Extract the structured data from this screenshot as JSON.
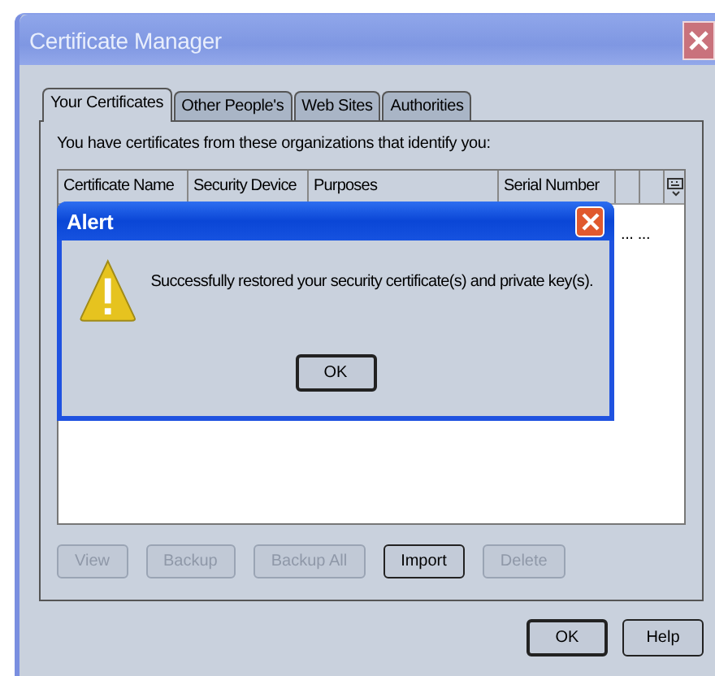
{
  "window": {
    "title": "Certificate Manager"
  },
  "tabs": [
    {
      "label": "Your Certificates",
      "selected": true
    },
    {
      "label": "Other People's",
      "selected": false
    },
    {
      "label": "Web Sites",
      "selected": false
    },
    {
      "label": "Authorities",
      "selected": false
    }
  ],
  "intro": "You have certificates from these organizations that identify you:",
  "table": {
    "columns": [
      "Certificate Name",
      "Security Device",
      "Purposes",
      "Serial Number"
    ],
    "rows": [
      {
        "column_5": "... ..."
      }
    ]
  },
  "actions": [
    {
      "label": "View",
      "disabled": true
    },
    {
      "label": "Backup",
      "disabled": true
    },
    {
      "label": "Backup All",
      "disabled": true
    },
    {
      "label": "Import",
      "disabled": false
    },
    {
      "label": "Delete",
      "disabled": true
    }
  ],
  "footer_buttons": [
    {
      "label": "OK",
      "default": true
    },
    {
      "label": "Help",
      "default": false
    }
  ],
  "alert": {
    "title": "Alert",
    "message": "Successfully restored your security certificate(s) and private key(s).",
    "button": "OK"
  }
}
